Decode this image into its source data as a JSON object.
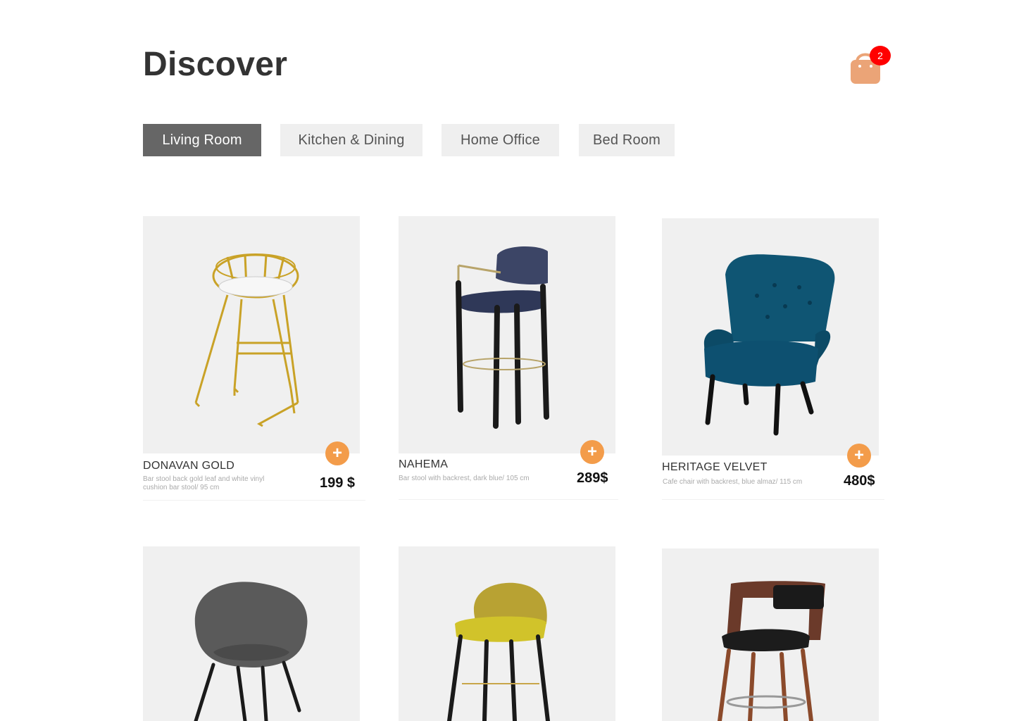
{
  "header": {
    "title": "Discover",
    "cart_count": "2",
    "cart_icon": "shopping-bag-icon"
  },
  "colors": {
    "accent": "#f39c4a",
    "badge": "#ff0000",
    "tab_active": "#666666",
    "tab_inactive": "#efefef",
    "card_bg": "#f0f0f0"
  },
  "tabs": [
    {
      "label": "Living Room",
      "active": true
    },
    {
      "label": "Kitchen & Dining",
      "active": false
    },
    {
      "label": "Home Office",
      "active": false
    },
    {
      "label": "Bed Room",
      "active": false
    }
  ],
  "products": [
    {
      "name": "DONAVAN GOLD",
      "description": "Bar stool back gold leaf and white vinyl cushion bar stool/ 95 cm",
      "price": "199 $",
      "add_label": "+"
    },
    {
      "name": "NAHEMA",
      "description": "Bar stool with backrest, dark blue/ 105 cm",
      "price": "289$",
      "add_label": "+"
    },
    {
      "name": "HERITAGE VELVET",
      "description": "Cafe chair with backrest, blue almaz/ 115 cm",
      "price": "480$",
      "add_label": "+"
    },
    {
      "name": "",
      "description": "",
      "price": "",
      "add_label": ""
    },
    {
      "name": "",
      "description": "",
      "price": "",
      "add_label": ""
    },
    {
      "name": "",
      "description": "",
      "price": "",
      "add_label": ""
    }
  ]
}
